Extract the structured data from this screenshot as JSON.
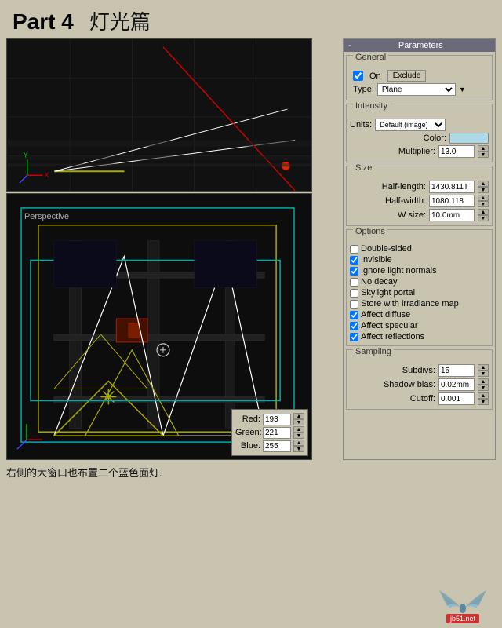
{
  "header": {
    "part_label": "Part 4",
    "chinese_title": "灯光篇"
  },
  "viewports": {
    "top_label": "",
    "bottom_label": "Perspective"
  },
  "rgb_values": {
    "red_label": "Red:",
    "red_value": "193",
    "green_label": "Green:",
    "green_value": "221",
    "blue_label": "Blue:",
    "blue_value": "255"
  },
  "params": {
    "title": "Parameters",
    "minimize_btn": "-",
    "general_label": "General",
    "on_label": "On",
    "exclude_label": "Exclude",
    "type_label": "Type:",
    "type_value": "Plane",
    "intensity_label": "Intensity",
    "units_label": "Units:",
    "units_value": "Default (image)",
    "color_label": "Color:",
    "multiplier_label": "Multiplier:",
    "multiplier_value": "13.0",
    "size_label": "Size",
    "half_length_label": "Half-length:",
    "half_length_value": "1430.811T",
    "half_width_label": "Half-width:",
    "half_width_value": "1080.118",
    "w_size_label": "W size:",
    "w_size_value": "10.0mm",
    "options_label": "Options",
    "double_sided_label": "Double-sided",
    "double_sided_checked": false,
    "invisible_label": "Invisible",
    "invisible_checked": true,
    "ignore_light_normals_label": "Ignore light normals",
    "ignore_light_normals_checked": true,
    "no_decay_label": "No decay",
    "no_decay_checked": false,
    "skylight_portal_label": "Skylight portal",
    "skylight_portal_checked": false,
    "store_irradiance_label": "Store with irradiance map",
    "store_irradiance_checked": false,
    "affect_diffuse_label": "Affect diffuse",
    "affect_diffuse_checked": true,
    "affect_specular_label": "Affect specular",
    "affect_specular_checked": true,
    "affect_reflections_label": "Affect reflections",
    "affect_reflections_checked": true,
    "sampling_label": "Sampling",
    "subdivs_label": "Subdivs:",
    "subdivs_value": "15",
    "shadow_bias_label": "Shadow bias:",
    "shadow_bias_value": "0.02mm",
    "cutoff_label": "Cutoff:",
    "cutoff_value": "0.001"
  },
  "caption": {
    "text": "右侧的大窗口也布置二个蓝色面灯."
  },
  "watermark": {
    "site": "jb51.net"
  }
}
